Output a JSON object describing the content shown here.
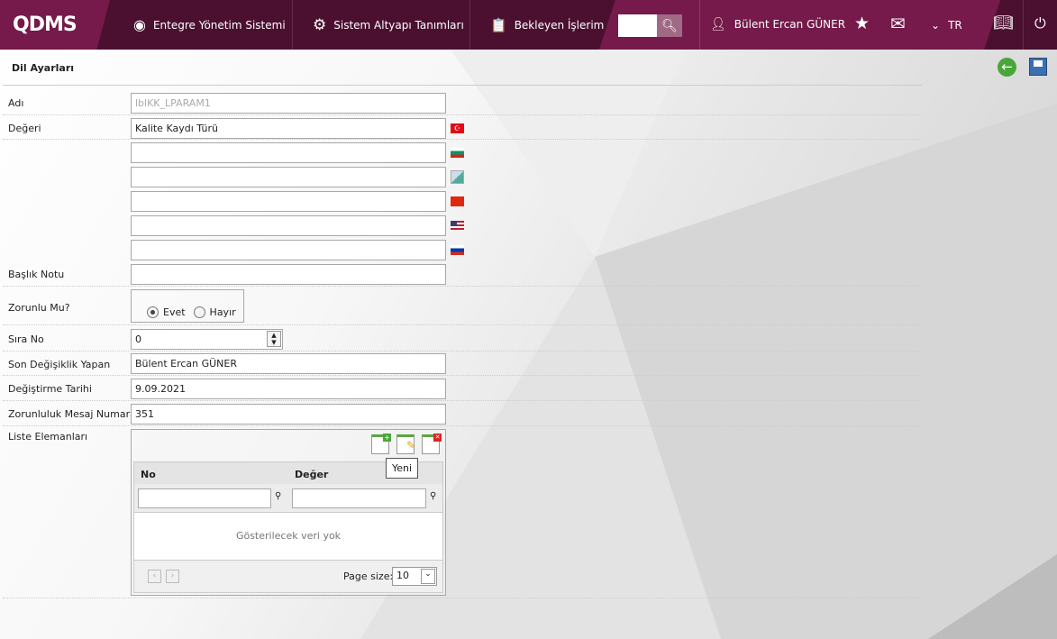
{
  "nav": {
    "logo": "QDMS",
    "items": [
      "Entegre Yönetim Sistemi",
      "Sistem Altyapı Tanımları",
      "Bekleyen İşlerim"
    ],
    "search_value": "",
    "user": "Bülent Ercan GÜNER",
    "language": "TR"
  },
  "page": {
    "title": "Dil Ayarları"
  },
  "form": {
    "adi_label": "Adı",
    "adi_value": "lblKK_LPARAM1",
    "degeri_label": "Değeri",
    "degeri_values": [
      "Kalite Kaydı Türü",
      "",
      "",
      "",
      "",
      ""
    ],
    "flags": [
      "turkey",
      "bulgaria",
      "broken-image",
      "china",
      "usa",
      "russia"
    ],
    "baslik_label": "Başlık Notu",
    "baslik_value": "",
    "zorunlu_label": "Zorunlu Mu?",
    "evet": "Evet",
    "hayir": "Hayır",
    "zorunlu_selected": "Evet",
    "sira_label": "Sıra No",
    "sira_value": "0",
    "son_label": "Son Değişiklik Yapan",
    "son_value": "Bülent Ercan GÜNER",
    "tarih_label": "Değiştirme Tarihi",
    "tarih_value": "9.09.2021",
    "mesaj_label": "Zorunluluk Mesaj Numarası",
    "mesaj_value": "351",
    "liste_label": "Liste Elemanları"
  },
  "grid": {
    "columns": [
      "No",
      "Değer"
    ],
    "tooltip": "Yeni",
    "empty": "Gösterilecek veri yok",
    "page_size_label": "Page size:",
    "page_size": "10"
  }
}
